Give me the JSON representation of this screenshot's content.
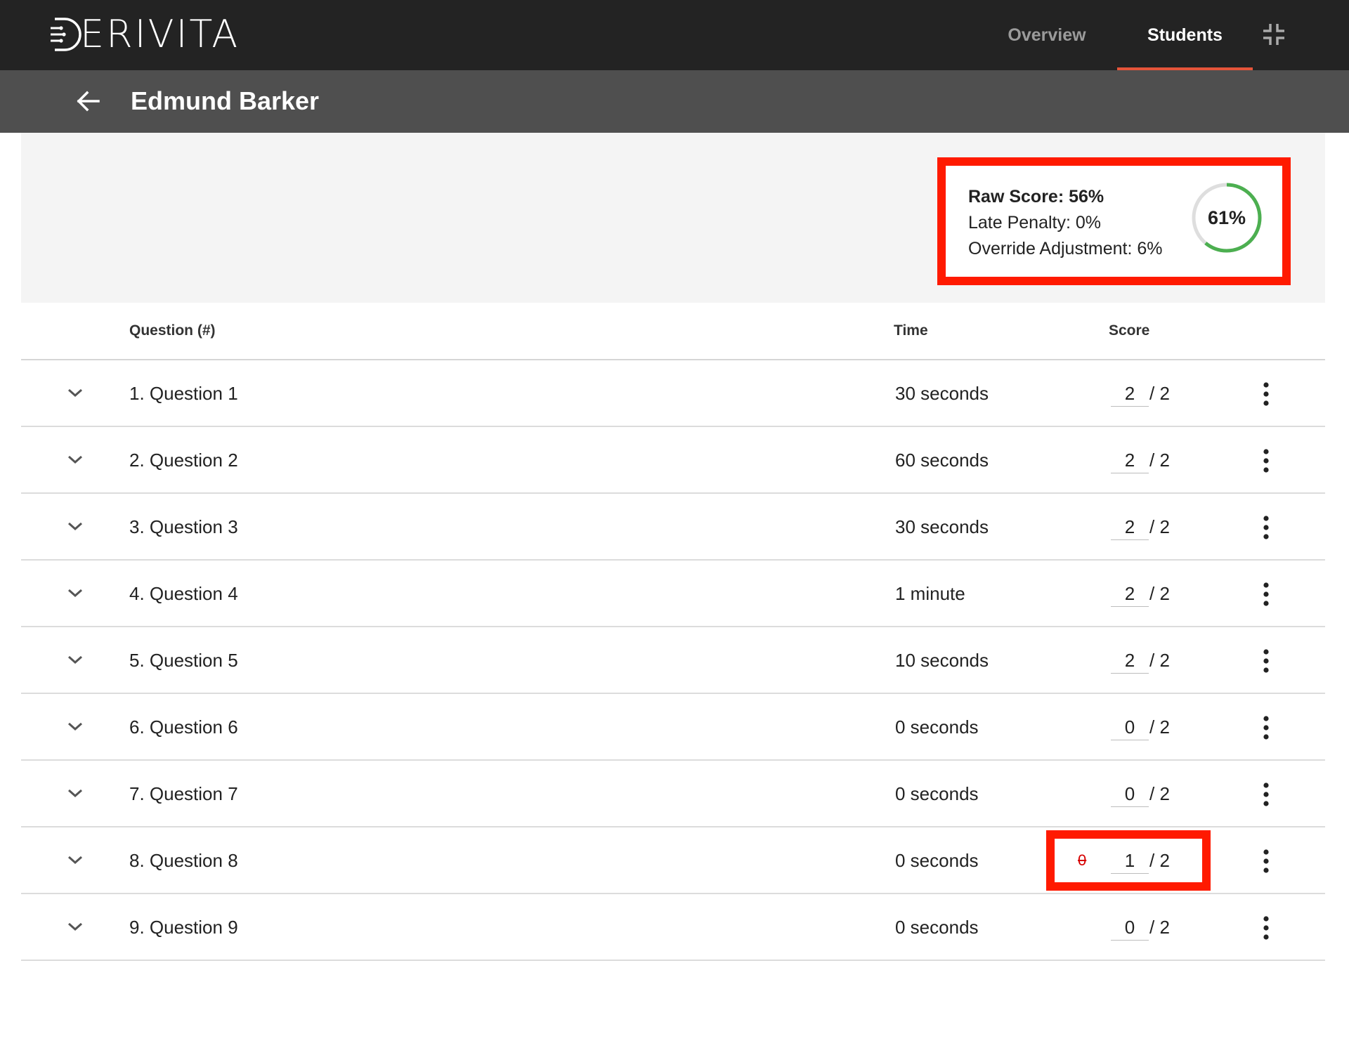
{
  "brand": {
    "name": "ERIVITA",
    "logo_icon": "d-circuit-logo-icon"
  },
  "nav": {
    "tabs": [
      {
        "label": "Overview",
        "active": false
      },
      {
        "label": "Students",
        "active": true
      }
    ],
    "collapse_icon": "collapse-arrows-icon",
    "active_accent": "#e5553a"
  },
  "student": {
    "name": "Edmund Barker",
    "back_icon": "arrow-left-icon"
  },
  "summary": {
    "raw_score": "Raw Score: 56%",
    "late_penalty": "Late Penalty: 0%",
    "override_adjustment": "Override Adjustment: 6%",
    "total_label": "61%",
    "total_fraction": 0.61,
    "gauge_color": "#4caf50",
    "highlight_color": "#ff1a00"
  },
  "table": {
    "headers": {
      "question": "Question (#)",
      "time": "Time",
      "score": "Score"
    },
    "rows": [
      {
        "question": "1. Question 1",
        "time": "30 seconds",
        "score": "2",
        "max": "/ 2"
      },
      {
        "question": "2. Question 2",
        "time": "60 seconds",
        "score": "2",
        "max": "/ 2"
      },
      {
        "question": "3. Question 3",
        "time": "30 seconds",
        "score": "2",
        "max": "/ 2"
      },
      {
        "question": "4. Question 4",
        "time": "1 minute",
        "score": "2",
        "max": "/ 2"
      },
      {
        "question": "5. Question 5",
        "time": "10 seconds",
        "score": "2",
        "max": "/ 2"
      },
      {
        "question": "6. Question 6",
        "time": "0 seconds",
        "score": "0",
        "max": "/ 2"
      },
      {
        "question": "7. Question 7",
        "time": "0 seconds",
        "score": "0",
        "max": "/ 2"
      },
      {
        "question": "8. Question 8",
        "time": "0 seconds",
        "score": "1",
        "max": "/ 2",
        "original_score": "0"
      },
      {
        "question": "9. Question 9",
        "time": "0 seconds",
        "score": "0",
        "max": "/ 2"
      }
    ]
  }
}
